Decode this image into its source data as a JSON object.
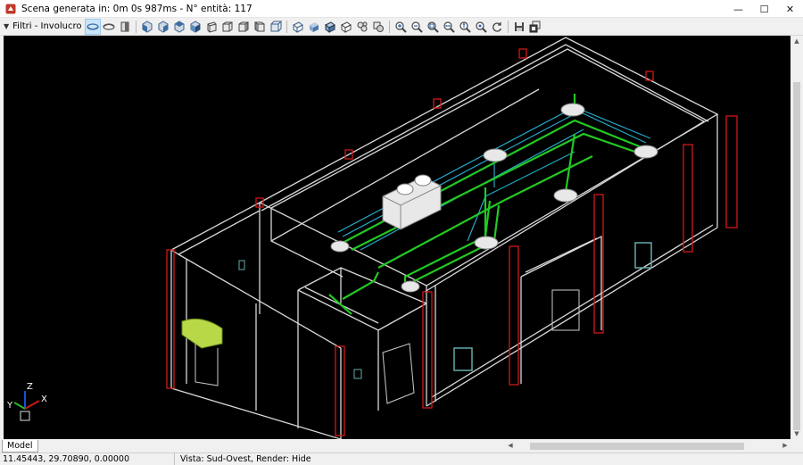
{
  "window": {
    "title": "Scena generata in: 0m 0s 987ms - N° entità: 117",
    "minimize_glyph": "—",
    "maximize_glyph": "☐",
    "close_glyph": "✕"
  },
  "toolbar": {
    "filter_label": "Filtri - Involucro",
    "caret_glyph": "▼",
    "buttons": [
      "view-top-icon",
      "view-bottom-icon",
      "view-side-icon",
      "view-front-icon",
      "view-left-icon",
      "view-right-icon",
      "view-back-icon",
      "iso-sw-icon",
      "iso-se-icon",
      "iso-ne-icon",
      "iso-nw-icon",
      "box-view-icon",
      "wireframe-icon",
      "shade-icon",
      "shade-edges-icon",
      "hide-icon",
      "render-icon",
      "render-alt-icon",
      "zoom-in-icon",
      "zoom-out-icon",
      "zoom-window-icon",
      "zoom-extents-icon",
      "zoom-realtime-icon",
      "pan-icon",
      "rotate-icon",
      "save-icon",
      "export-icon"
    ]
  },
  "viewport": {
    "axis_labels": {
      "z": "Z",
      "y": "Y",
      "x": "X"
    },
    "colors": {
      "background": "#000000",
      "walls": "#d8d8d8",
      "pillars": "#d01818",
      "pipes": "#22c822",
      "ducts": "#28a8c8",
      "unit": "#e8e8e8",
      "grille": "#b8d848"
    }
  },
  "bottom": {
    "model_tab": "Model",
    "left_arrow": "◀",
    "right_arrow": "▶",
    "up_arrow": "▲",
    "down_arrow": "▼"
  },
  "status": {
    "coords": "11.45443, 29.70890, 0.00000",
    "view": "Vista: Sud-Ovest, Render: Hide"
  }
}
